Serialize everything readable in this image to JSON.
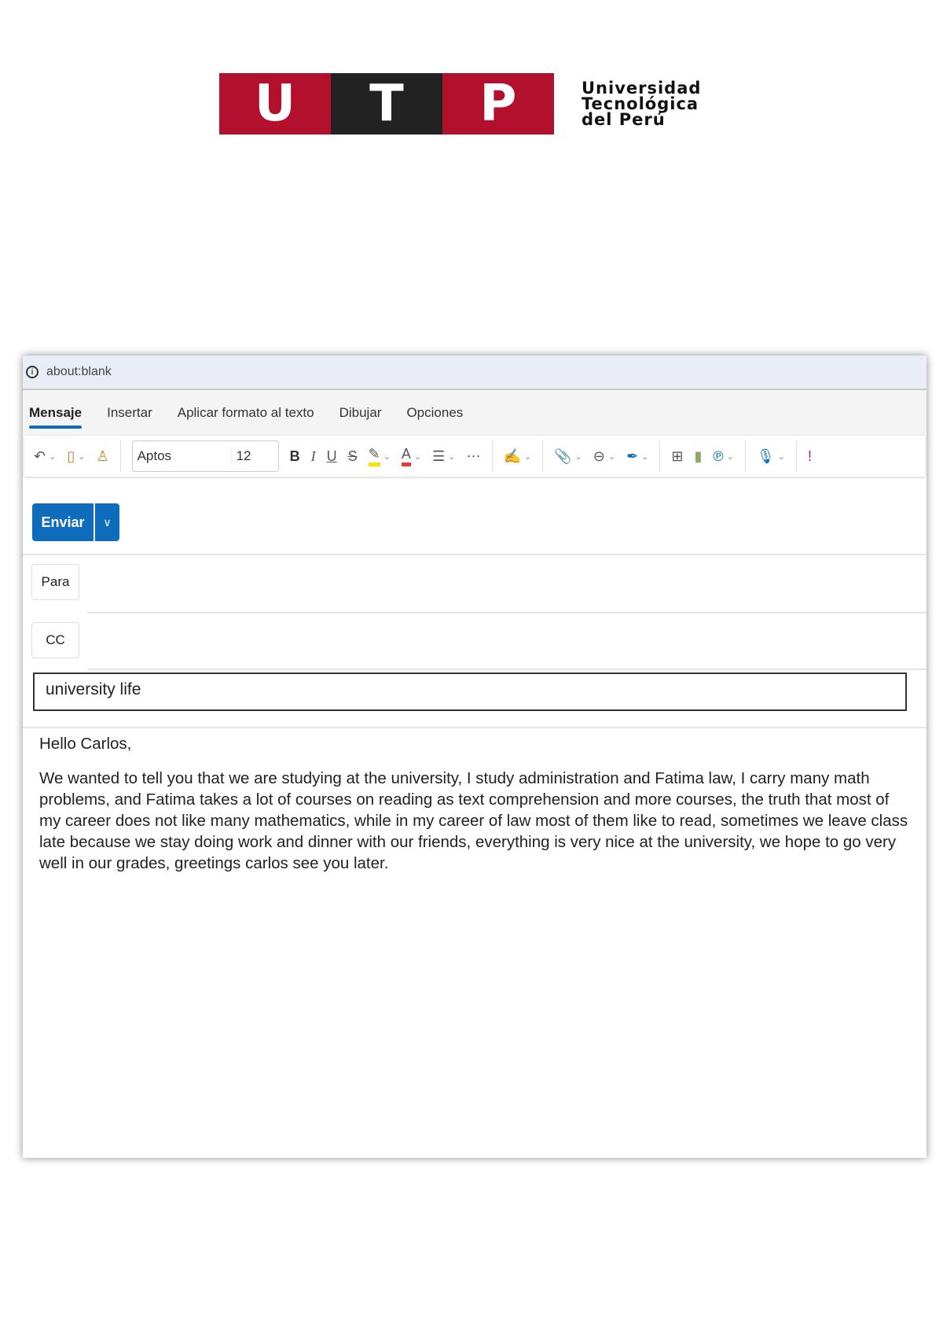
{
  "logo": {
    "letters": [
      "U",
      "T",
      "P"
    ],
    "text_lines": [
      "Universidad",
      "Tecnológica",
      "del Perú"
    ],
    "colors": {
      "red": "#b3102e",
      "dark": "#222222"
    }
  },
  "browser": {
    "address": "about:blank"
  },
  "tabs": [
    "Mensaje",
    "Insertar",
    "Aplicar formato al texto",
    "Dibujar",
    "Opciones"
  ],
  "toolbar": {
    "font": "Aptos",
    "size": "12",
    "icons": [
      "undo-icon",
      "paste-icon",
      "format-painter-icon",
      "bold-icon",
      "italic-icon",
      "underline-icon",
      "strikethrough-icon",
      "highlight-icon",
      "font-color-icon",
      "line-spacing-icon",
      "more-icon",
      "editor-icon",
      "attach-icon",
      "link-icon",
      "signature-icon",
      "apps-icon",
      "insights-icon",
      "copilot-icon",
      "dictate-icon",
      "importance-icon"
    ]
  },
  "compose": {
    "send": "Enviar",
    "to": "Para",
    "cc": "CC",
    "subject": "university life",
    "greeting": "Hello Carlos,",
    "body": "We wanted to tell you that we are studying at the university, I study administration and Fatima law, I carry many math problems, and Fatima takes a lot of courses on reading as text comprehension and more courses, the truth that most of my career does not like many mathematics, while in my career of law most of them like to read, sometimes we leave class late because we stay doing work and dinner with our friends, everything is very nice at the university, we hope to go very well in our grades, greetings carlos see you later."
  }
}
